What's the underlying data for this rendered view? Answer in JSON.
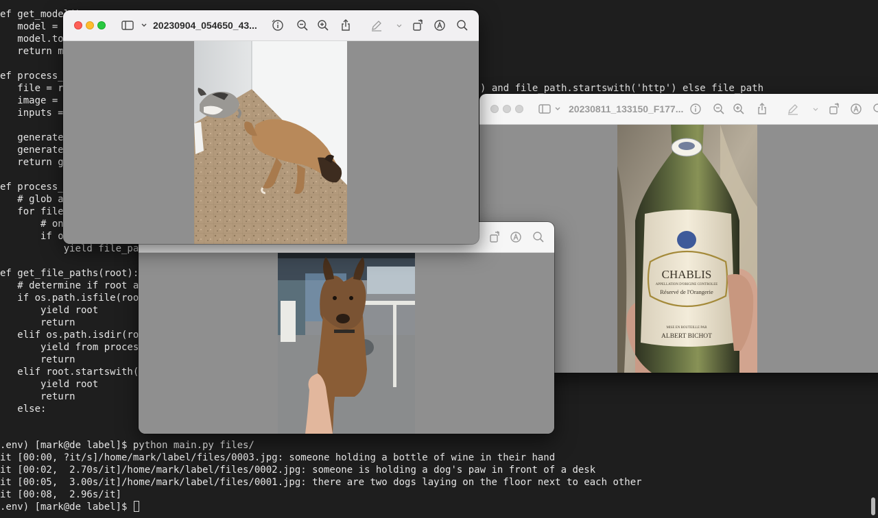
{
  "terminal": {
    "code_lines": [
      "ef get_model():",
      "   model = ",
      "   model.to",
      "   return m",
      "",
      "ef process_",
      "   file = r",
      "   image = ",
      "   inputs =",
      "",
      "   generate",
      "   generate",
      "   return g",
      "",
      "ef process_",
      "   # glob a",
      "   for file",
      "       # on",
      "       if o",
      "           yield file_pa",
      "",
      "ef get_file_paths(root):",
      "   # determine if root a",
      "   if os.path.isfile(roo",
      "       yield root",
      "       return",
      "   elif os.path.isdir(ro",
      "       yield from proces",
      "       return",
      "   elif root.startswith(",
      "       yield root",
      "       return",
      "   else:"
    ],
    "partial_line": ") and file_path.startswith('http') else file_path",
    "output_lines": [
      ".env) [mark@de label]$ python main.py files/",
      "it [00:00, ?it/s]/home/mark/label/files/0003.jpg: someone holding a bottle of wine in their hand",
      "it [00:02,  2.70s/it]/home/mark/label/files/0002.jpg: someone is holding a dog's paw in front of a desk",
      "it [00:05,  3.00s/it]/home/mark/label/files/0001.jpg: there are two dogs laying on the floor next to each other",
      "it [00:08,  2.96s/it]"
    ],
    "prompt": ".env) [mark@de label]$ "
  },
  "windows": {
    "front": {
      "title": "20230904_054650_43..."
    },
    "right": {
      "title": "20230811_133150_F177..."
    },
    "bottom": {
      "title": ""
    }
  },
  "wine_label": {
    "name": "CHABLIS",
    "appellation": "APPELLATION D'ORIGINE CONTROLEE",
    "cuvee": "Réservé de l'Orangerie",
    "bottled_by": "MISE EN BOUTEILLE PAR",
    "producer": "ALBERT BICHOT"
  },
  "icons": [
    "sidebar-icon",
    "chevron-down-icon",
    "info-icon",
    "zoom-out-icon",
    "zoom-in-icon",
    "share-icon",
    "markup-pen-icon",
    "rotate-icon",
    "markup-circle-icon",
    "search-icon"
  ]
}
